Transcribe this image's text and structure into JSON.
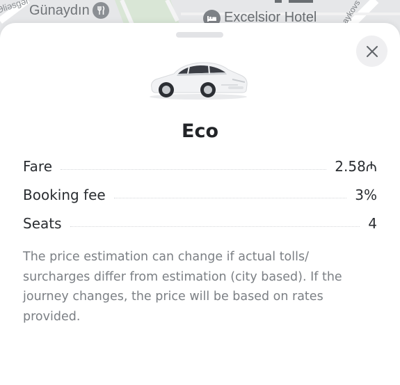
{
  "map": {
    "labels": {
      "street_left": "Əliəsgər",
      "restaurant": "Günaydın",
      "hotel": "Excelsior Hotel",
      "street_right": "aykovs"
    },
    "icons": {
      "restaurant": "restaurant-icon",
      "hotel": "hotel-icon"
    }
  },
  "sheet": {
    "title": "Eco",
    "close_icon": "close-icon",
    "car_icon": "car-image",
    "details": [
      {
        "label": "Fare",
        "value": "2.58₼"
      },
      {
        "label": "Booking fee",
        "value": "3%"
      },
      {
        "label": "Seats",
        "value": "4"
      }
    ],
    "note": "The price estimation can change if actual tolls/ surcharges differ from estimation (city based). If the journey changes, the price will be based on rates provided."
  },
  "colors": {
    "sheet_background": "#ffffff",
    "title_text": "#222428",
    "body_text": "#2a2d31",
    "note_text": "#7b7f84",
    "close_button_bg": "#efeff1",
    "map_background": "#e6e7e9"
  }
}
